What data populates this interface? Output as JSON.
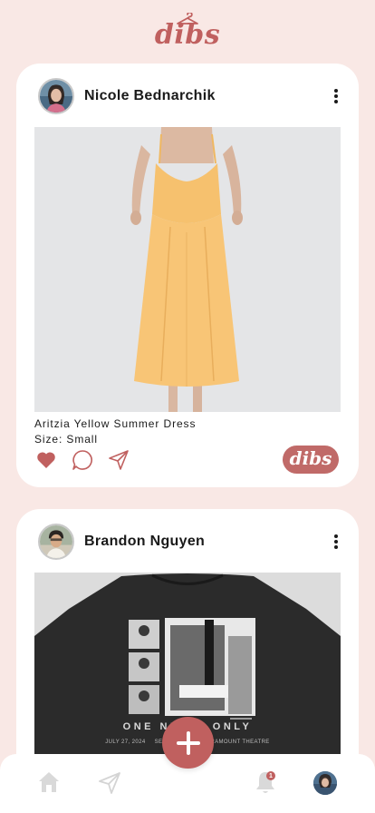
{
  "app": {
    "logo_text": "dibs",
    "brand_color": "#c0605f",
    "background_color": "#f9e8e5"
  },
  "posts": [
    {
      "username": "Nicole Bednarchik",
      "avatar_icon": "user-avatar",
      "photo_subject": "yellow-summer-dress",
      "item_title": "Aritzia Yellow Summer Dress",
      "item_size": "Size: Small",
      "liked": true,
      "dibs_label": "dibs"
    },
    {
      "username": "Brandon Nguyen",
      "avatar_icon": "user-avatar",
      "photo_subject": "concert-tshirt",
      "tshirt_text": "ONE NIGHT ONLY",
      "tshirt_date": "JULY 27, 2024",
      "tshirt_city": "SEATTLE, WA",
      "tshirt_venue": "PARAMOUNT THEATRE"
    }
  ],
  "nav": {
    "items": [
      "home-icon",
      "send-icon",
      "add-icon",
      "bell-icon",
      "profile-avatar"
    ],
    "notification_count": "1"
  }
}
